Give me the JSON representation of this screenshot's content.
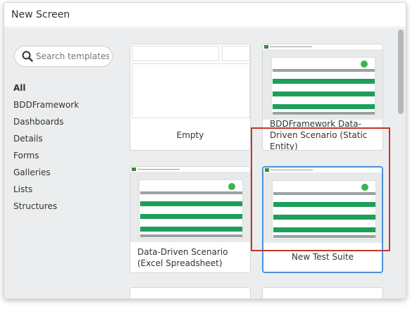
{
  "window": {
    "title": "New Screen"
  },
  "search": {
    "placeholder": "Search templates"
  },
  "categories": [
    "All",
    "BDDFramework",
    "Dashboards",
    "Details",
    "Forms",
    "Galleries",
    "Lists",
    "Structures"
  ],
  "templates": [
    {
      "label": "Empty"
    },
    {
      "label": "BDDFramework Data-Driven Scenario (Static Entity)"
    },
    {
      "label": "Data-Driven Scenario (Excel Spreadsheet)"
    },
    {
      "label": "New Test Suite"
    }
  ],
  "colors": {
    "selection": "#4a90d9",
    "highlight": "#c0392b",
    "green": "#1e9e5a"
  }
}
